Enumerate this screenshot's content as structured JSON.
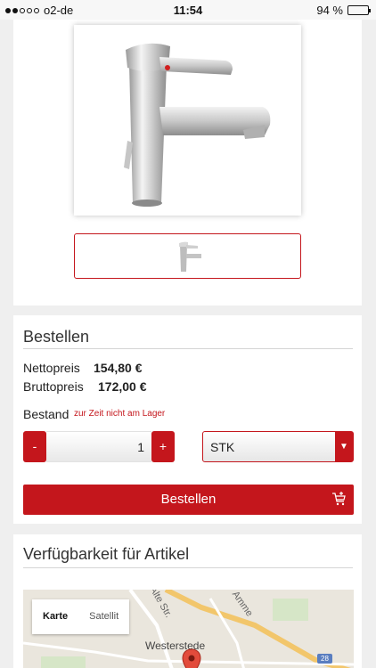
{
  "status": {
    "carrier": "o2-de",
    "time": "11:54",
    "battery": "94 %",
    "battery_level": 0.94,
    "signal_bars": 2
  },
  "gallery": {
    "main_image_icon": "faucet-icon",
    "thumbnail_icon": "faucet-thumbnail-icon"
  },
  "order": {
    "title": "Bestellen",
    "net_label": "Nettopreis",
    "net_value": "154,80 €",
    "gross_label": "Bruttopreis",
    "gross_value": "172,00 €",
    "stock_label": "Bestand",
    "stock_status": "zur Zeit nicht am Lager",
    "minus_label": "-",
    "plus_label": "+",
    "quantity": "1",
    "unit": "STK",
    "button_label": "Bestellen",
    "accent_color": "#c4161c"
  },
  "availability": {
    "title": "Verfügbarkeit für Artikel",
    "map": {
      "tab_map": "Karte",
      "tab_satellite": "Satellit",
      "town": "Westerstede",
      "street_1": "Alte Str.",
      "street_2": "Amme",
      "road_number": "28"
    }
  }
}
